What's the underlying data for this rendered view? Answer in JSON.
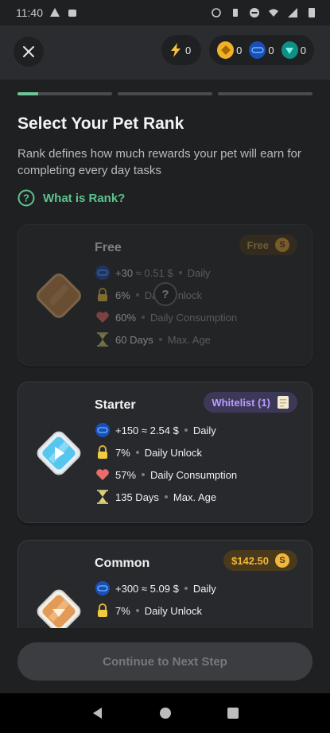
{
  "status_bar": {
    "time": "11:40"
  },
  "header": {
    "energy_count": "0",
    "token_1_count": "0",
    "token_2_count": "0",
    "token_3_count": "0"
  },
  "progress": {
    "steps": 3,
    "current_step_fill": 0.22
  },
  "page": {
    "title": "Select Your Pet Rank",
    "subtitle": "Rank defines how much rewards your pet will earn for completing every day tasks",
    "rank_link": "What is Rank?"
  },
  "cards": {
    "free": {
      "name": "Free",
      "tag": "Free",
      "reward": "+30",
      "reward_usd": "≈ 0.51 $",
      "reward_period": "Daily",
      "unlock": "6%",
      "unlock_label": "Daily Unlock",
      "consumption": "60%",
      "consumption_label": "Daily Consumption",
      "age": "60 Days",
      "age_label": "Max. Age",
      "help_icon": "?"
    },
    "starter": {
      "name": "Starter",
      "tag": "Whitelist (1)",
      "reward": "+150",
      "reward_usd": "≈ 2.54 $",
      "reward_period": "Daily",
      "unlock": "7%",
      "unlock_label": "Daily Unlock",
      "consumption": "57%",
      "consumption_label": "Daily Consumption",
      "age": "135 Days",
      "age_label": "Max. Age"
    },
    "common": {
      "name": "Common",
      "tag": "$142.50",
      "reward": "+300",
      "reward_usd": "≈ 5.09 $",
      "reward_period": "Daily",
      "unlock": "7%",
      "unlock_label": "Daily Unlock"
    }
  },
  "footer": {
    "continue_label": "Continue to Next Step"
  },
  "colors": {
    "accent_green": "#5cc48e",
    "whitelist_purple": "#b79cff",
    "price_gold": "#f2b63a"
  }
}
